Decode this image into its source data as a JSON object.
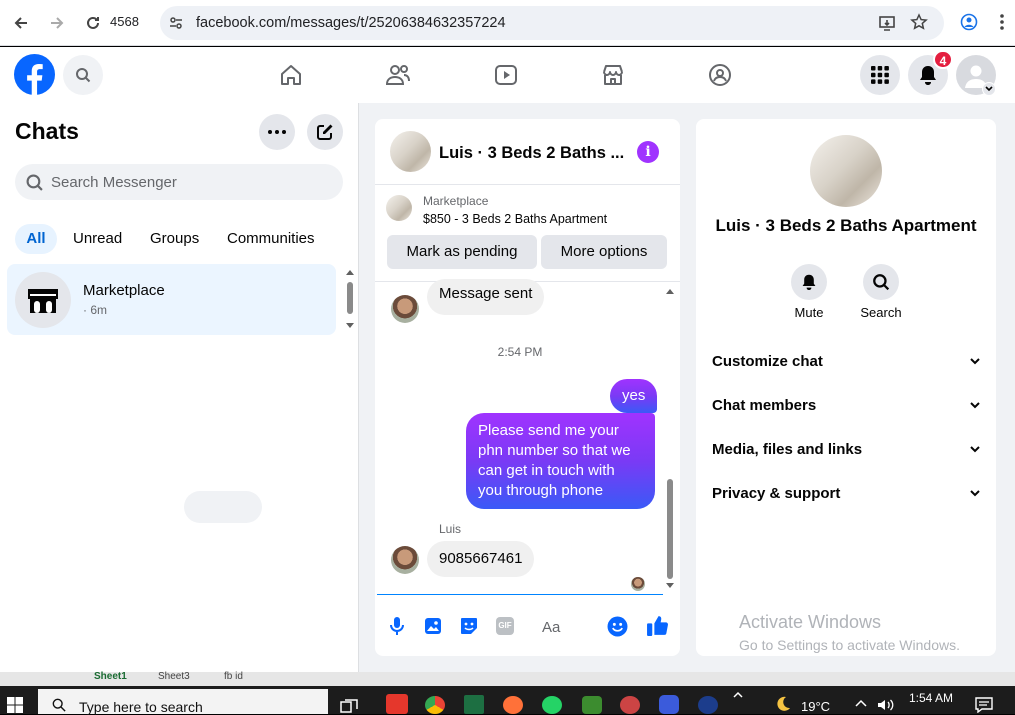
{
  "browser": {
    "tab_count": "4568",
    "url": "facebook.com/messages/t/25206384632357224"
  },
  "header": {
    "notification_count": "4"
  },
  "sidebar": {
    "title": "Chats",
    "search_placeholder": "Search Messenger",
    "filters": [
      "All",
      "Unread",
      "Groups",
      "Communities"
    ],
    "chat": {
      "name": "Marketplace",
      "time": "· 6m"
    }
  },
  "conversation": {
    "title": "Luis · 3 Beds 2 Baths ...",
    "listing_source": "Marketplace",
    "listing_title": "$850 - 3 Beds 2 Baths Apartment",
    "mark_pending": "Mark as pending",
    "more_options": "More options",
    "messages": [
      {
        "type": "in",
        "text": "Message sent"
      },
      {
        "type": "time",
        "text": "2:54 PM"
      },
      {
        "type": "out",
        "text": "yes"
      },
      {
        "type": "out",
        "text": "Please send me your phn number so that we can get in touch with you through phone"
      },
      {
        "type": "sender",
        "text": "Luis"
      },
      {
        "type": "in",
        "text": "9085667461"
      }
    ],
    "composer_placeholder": "Aa",
    "gif_label": "GIF"
  },
  "right_panel": {
    "name": "Luis · 3 Beds 2 Baths Apartment",
    "mute_label": "Mute",
    "search_label": "Search",
    "sections": [
      "Customize chat",
      "Chat members",
      "Media, files and links",
      "Privacy & support"
    ]
  },
  "watermark": {
    "line1": "Activate Windows",
    "line2": "Go to Settings to activate Windows."
  },
  "sheets": [
    "Sheet1",
    "Sheet3",
    "fb id"
  ],
  "taskbar": {
    "search_placeholder": "Type here to search",
    "temperature": "19°C",
    "time": "1:54 AM"
  },
  "colors": {
    "fb_blue": "#0866ff",
    "messenger_purple": "#a033ff",
    "active_chat_bg": "#ebf5ff"
  }
}
